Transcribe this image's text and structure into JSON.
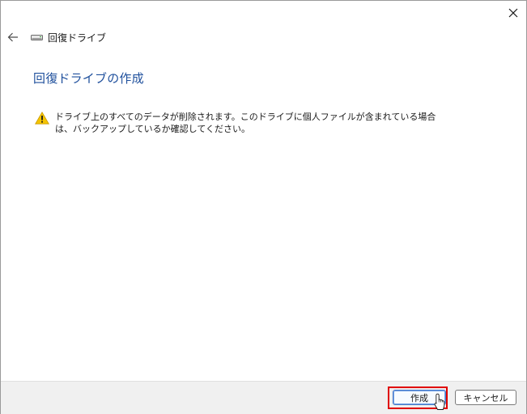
{
  "window": {
    "close_icon": "close-icon",
    "back_icon": "back-arrow-icon"
  },
  "nav": {
    "title": "回復ドライブ",
    "icon": "drive-icon"
  },
  "main": {
    "heading": "回復ドライブの作成",
    "warning_icon": "warning-icon",
    "warning_text": "ドライブ上のすべてのデータが削除されます。このドライブに個人ファイルが含まれている場合は、バックアップしているか確認してください。"
  },
  "footer": {
    "create_label": "作成",
    "cancel_label": "キャンセル"
  },
  "colors": {
    "heading": "#1e4f9c",
    "highlight": "#e00000",
    "warning": "#f5c400"
  }
}
